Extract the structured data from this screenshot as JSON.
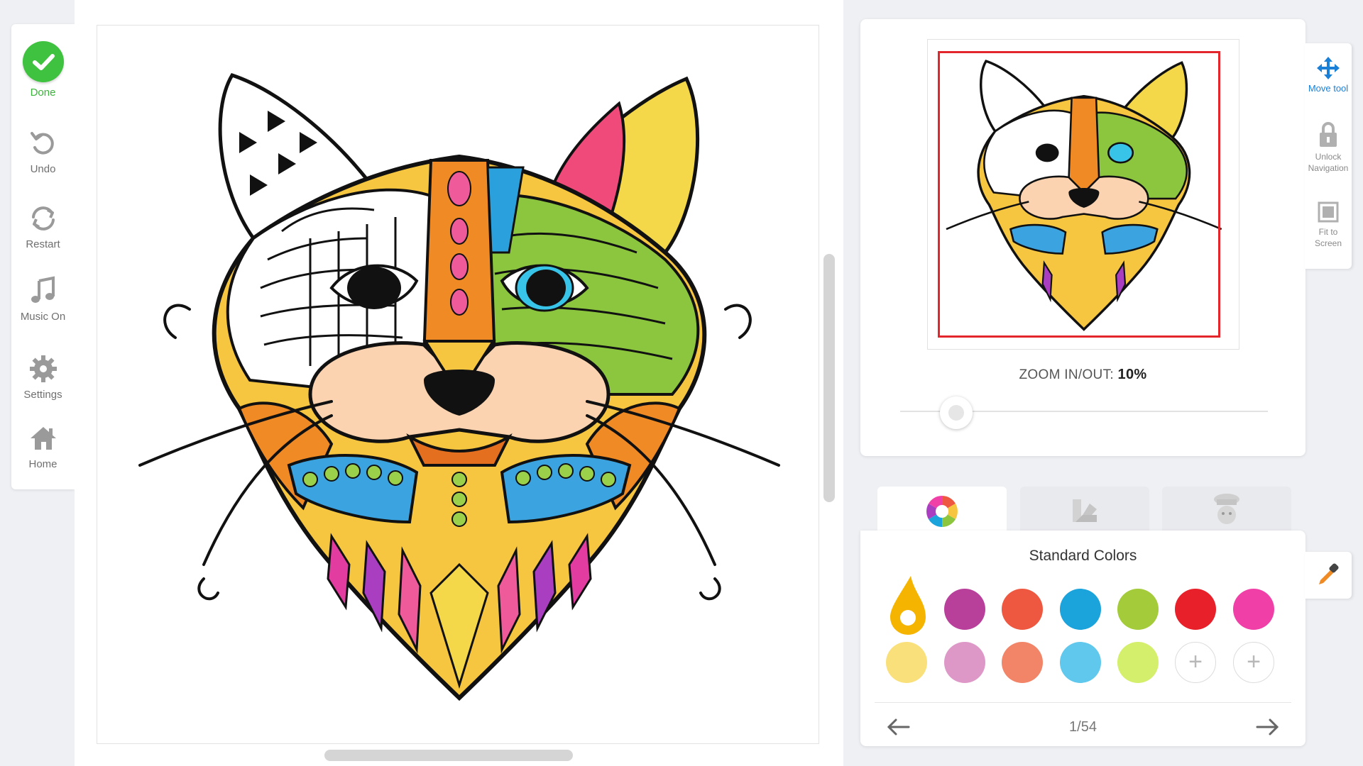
{
  "toolbar": {
    "done": "Done",
    "undo": "Undo",
    "restart": "Restart",
    "music": "Music On",
    "settings": "Settings",
    "home": "Home"
  },
  "navigator": {
    "zoom_label": "ZOOM IN/OUT:",
    "zoom_value": "10%",
    "zoom_level": 0.1
  },
  "side_tools": {
    "move_tool": "Move tool",
    "unlock_line1": "Unlock",
    "unlock_line2": "Navigation",
    "fit_line1": "Fit to",
    "fit_line2": "Screen"
  },
  "tabs": [
    {
      "icon": "color-wheel-icon"
    },
    {
      "icon": "gradient-icon"
    },
    {
      "icon": "texture-icon"
    }
  ],
  "palette": {
    "title": "Standard Colors",
    "page": "1/54",
    "selected_color": "#f5b400",
    "row1": [
      "#b8409a",
      "#ef5840",
      "#1ba3dc",
      "#a3cb3a",
      "#e8202a",
      "#f040a8"
    ],
    "row2": [
      "#f9e07a",
      "#de98c8",
      "#f28468",
      "#5fc8ec",
      "#d4ef6c"
    ]
  },
  "colors": {
    "accent_green": "#3fc23f",
    "accent_blue": "#1a7fd6",
    "viewport_red": "#e3262b"
  }
}
